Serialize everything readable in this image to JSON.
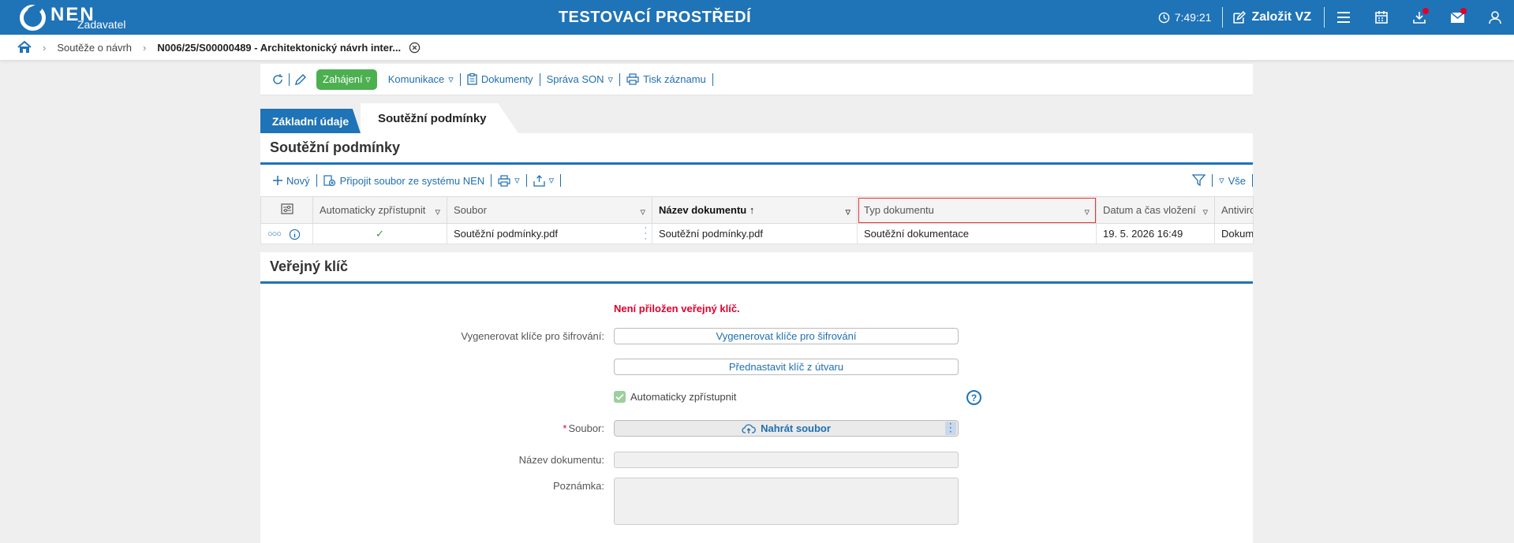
{
  "header": {
    "logo_text": "NEN",
    "logo_sub": "Zadavatel",
    "env_title": "TESTOVACÍ PROSTŘEDÍ",
    "clock": "7:49:21",
    "create_label": "Založit VZ",
    "colors": {
      "brand": "#1f73b7",
      "notification": "#e0002a"
    }
  },
  "breadcrumb": {
    "items": [
      "Soutěže o návrh",
      "N006/25/S00000489 - Architektonický návrh inter..."
    ]
  },
  "toolbar": {
    "start_label": "Zahájení",
    "communication_label": "Komunikace",
    "documents_label": "Dokumenty",
    "son_label": "Správa SON",
    "print_label": "Tisk záznamu"
  },
  "tabs": [
    "Základní údaje",
    "Soutěžní podmínky"
  ],
  "conditions": {
    "title": "Soutěžní podmínky",
    "new_label": "Nový",
    "attach_label": "Připojit soubor ze systému NEN",
    "all_label": "Vše",
    "columns": [
      "Automaticky zpřístupnit",
      "Soubor",
      "Název dokumentu",
      "Typ dokumentu",
      "Datum a čas vložení",
      "Antiviro"
    ],
    "rows": [
      {
        "auto": "✓",
        "file": "Soutěžní podmínky.pdf",
        "name": "Soutěžní podmínky.pdf",
        "type": "Soutěžní dokumentace",
        "date": "19. 5. 2026 16:49",
        "antivirus": "Dokume"
      }
    ]
  },
  "public_key": {
    "title": "Veřejný klíč",
    "warning": "Není přiložen veřejný klíč.",
    "generate_label": "Vygenerovat klíče pro šifrování:",
    "generate_button": "Vygenerovat klíče pro šifrování",
    "preset_button": "Přednastavit klíč z útvaru",
    "auto_label": "Automaticky zpřístupnit",
    "file_label": "Soubor:",
    "file_required": "*",
    "upload_button": "Nahrát soubor",
    "docname_label": "Název dokumentu:",
    "note_label": "Poznámka:",
    "help": "?"
  }
}
